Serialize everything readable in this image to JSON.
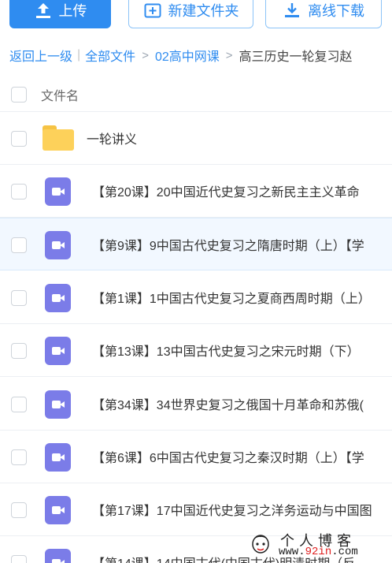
{
  "toolbar": {
    "upload_label": "上传",
    "new_folder_label": "新建文件夹",
    "offline_download_label": "离线下载"
  },
  "breadcrumb": {
    "back": "返回上一级",
    "separator_bar": "|",
    "all_files": "全部文件",
    "arrow": ">",
    "level1": "02高中网课",
    "current": "高三历史一轮复习赵"
  },
  "list": {
    "header_filename": "文件名",
    "rows": [
      {
        "type": "folder",
        "name": "一轮讲义"
      },
      {
        "type": "video",
        "name": "【第20课】20中国近代史复习之新民主主义革命"
      },
      {
        "type": "video",
        "name": "【第9课】9中国古代史复习之隋唐时期（上）【学"
      },
      {
        "type": "video",
        "name": "【第1课】1中国古代史复习之夏商西周时期（上）"
      },
      {
        "type": "video",
        "name": "【第13课】13中国古代史复习之宋元时期（下）"
      },
      {
        "type": "video",
        "name": "【第34课】34世界史复习之俄国十月革命和苏俄("
      },
      {
        "type": "video",
        "name": "【第6课】6中国古代史复习之秦汉时期（上）【学"
      },
      {
        "type": "video",
        "name": "【第17课】17中国近代史复习之洋务运动与中国图"
      },
      {
        "type": "video",
        "name": "【第14课】14中国古代(中国古代)明清时期（反"
      }
    ]
  },
  "watermark": {
    "title": "个人博客",
    "url_prefix": "www.",
    "url_red": "92in",
    "url_suffix": ".com"
  },
  "colors": {
    "accent": "#2f8cf0",
    "folder": "#fdd15a",
    "video_icon": "#7b7ce8",
    "row_highlight": "#f2f8ff"
  },
  "icons": {
    "upload": "upload-icon",
    "new_folder": "folder-plus-icon",
    "offline_download": "download-icon",
    "folder": "folder-icon",
    "video": "video-icon"
  }
}
